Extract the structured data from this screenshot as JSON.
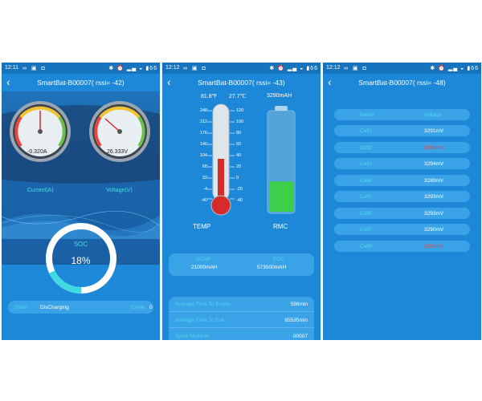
{
  "colors": {
    "primary": "#1e88d8",
    "statusbar": "#1673bd",
    "accent_cyan": "#4dd8e8",
    "warning_red": "#e8453c"
  },
  "status_icons": [
    "infinity-icon",
    "image-icon",
    "message-icon",
    "bluetooth-icon",
    "alarm-icon",
    "signal-icon",
    "wifi-icon",
    "battery-icon"
  ],
  "screens": [
    {
      "status": {
        "time": "12:11",
        "battery": "66"
      },
      "title": "SmartBat-B00007( rssi= -42)",
      "gauges": [
        {
          "label": "Current(A)",
          "value": "-0.320A",
          "ticks": [
            "-200",
            "-150",
            "-100",
            "-50",
            "0",
            "50",
            "100",
            "150",
            "200"
          ]
        },
        {
          "label": "Voltage(V)",
          "value": "26.333V",
          "ticks": [
            "0",
            "5",
            "10",
            "15",
            "20",
            "25",
            "30",
            "35",
            "40"
          ]
        }
      ],
      "soc": {
        "label": "SOC",
        "value": "18%",
        "percent": 18
      },
      "footer": {
        "state_label": "State:",
        "state_value": "DisCharging",
        "cycle_label": "Cycle:",
        "cycle_value": "0"
      }
    },
    {
      "status": {
        "time": "12:12",
        "battery": "66"
      },
      "title": "SmartBat-B00007( rssi= -43)",
      "temp_f": "81.8℉",
      "temp_c": "27.7℃",
      "rmc_value": "3290mAH",
      "scale_f": [
        "248",
        "212",
        "176",
        "140",
        "104",
        "68",
        "32",
        "-4",
        "-40"
      ],
      "scale_c": [
        "120",
        "100",
        "80",
        "60",
        "40",
        "20",
        "0",
        "-20",
        "-40"
      ],
      "temp_label": "TEMP",
      "rmc_label": "RMC",
      "rmc_fill_fraction": 0.3,
      "capacity": {
        "dcap_label": "DCAP",
        "dcap_value": "21000mAH",
        "fcc_label": "FCC",
        "fcc_value": "573500mAH"
      },
      "info": [
        {
          "k": "Average Time To Empty",
          "v": "598min"
        },
        {
          "k": "Average Time To Full",
          "v": "65535min"
        },
        {
          "k": "Serial Number:",
          "v": "00007"
        }
      ]
    },
    {
      "status": {
        "time": "12:12",
        "battery": "66"
      },
      "title": "SmartBat-B00007( rssi= -48)",
      "header": {
        "name": "Name",
        "voltage": "Voltage"
      },
      "cells": [
        {
          "name": "Cell1",
          "v": "3291mV",
          "alert": false
        },
        {
          "name": "Cell2",
          "v": "3289mV",
          "alert": true
        },
        {
          "name": "Cell3",
          "v": "3294mV",
          "alert": false
        },
        {
          "name": "Cell4",
          "v": "3289mV",
          "alert": false
        },
        {
          "name": "Cell5",
          "v": "3293mV",
          "alert": false
        },
        {
          "name": "Cell6",
          "v": "3293mV",
          "alert": false
        },
        {
          "name": "Cell7",
          "v": "3290mV",
          "alert": false
        },
        {
          "name": "Cell8",
          "v": "3296mV",
          "alert": true
        }
      ]
    }
  ]
}
